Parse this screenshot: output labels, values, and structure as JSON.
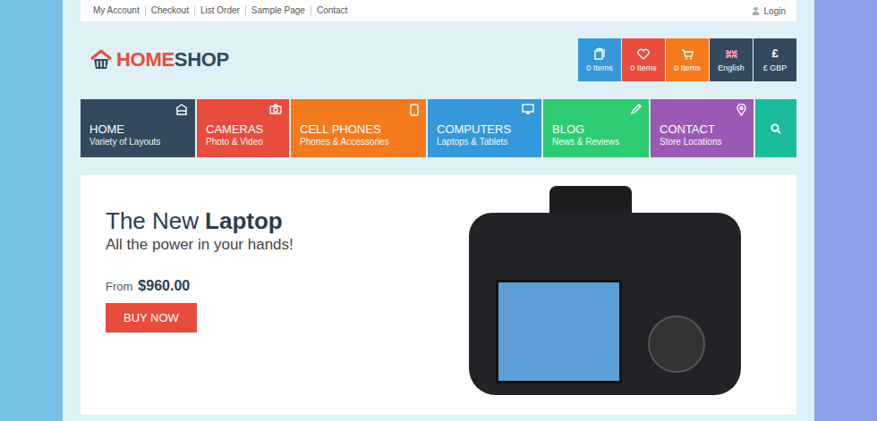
{
  "top_links": [
    "My Account",
    "Checkout",
    "List Order",
    "Sample Page",
    "Contact"
  ],
  "login": {
    "label": "Login"
  },
  "logo": {
    "part1": "HOME",
    "part2": "SHOP"
  },
  "header_boxes": [
    {
      "kind": "bag",
      "label": "0 Items",
      "color": "#3498db"
    },
    {
      "kind": "heart",
      "label": "0 Items",
      "color": "#e74c3c"
    },
    {
      "kind": "cart",
      "label": "0 Items",
      "color": "#f37b1d"
    },
    {
      "kind": "flag",
      "label": "English",
      "color": "#34495e"
    },
    {
      "kind": "currency",
      "symbol": "£",
      "label": "£ GBP",
      "color": "#34495e"
    }
  ],
  "nav": [
    {
      "kind": "home",
      "title": "HOME",
      "subtitle": "Variety of Layouts",
      "color": "#34495e"
    },
    {
      "kind": "camera",
      "title": "CAMERAS",
      "subtitle": "Photo & Video",
      "color": "#e74c3c"
    },
    {
      "kind": "phone",
      "title": "CELL PHONES",
      "subtitle": "Phones & Accessories",
      "color": "#f37b1d"
    },
    {
      "kind": "monitor",
      "title": "COMPUTERS",
      "subtitle": "Laptops & Tablets",
      "color": "#3498db"
    },
    {
      "kind": "pencil",
      "title": "BLOG",
      "subtitle": "News & Reviews",
      "color": "#2ecc71"
    },
    {
      "kind": "pin",
      "title": "CONTACT",
      "subtitle": "Store Locations",
      "color": "#9b59b6"
    }
  ],
  "banner": {
    "title_light": "The New",
    "title_bold": "Laptop",
    "subtitle": "All the power in your hands!",
    "price_label": "From",
    "price": "$960.00",
    "button": "BUY NOW"
  }
}
